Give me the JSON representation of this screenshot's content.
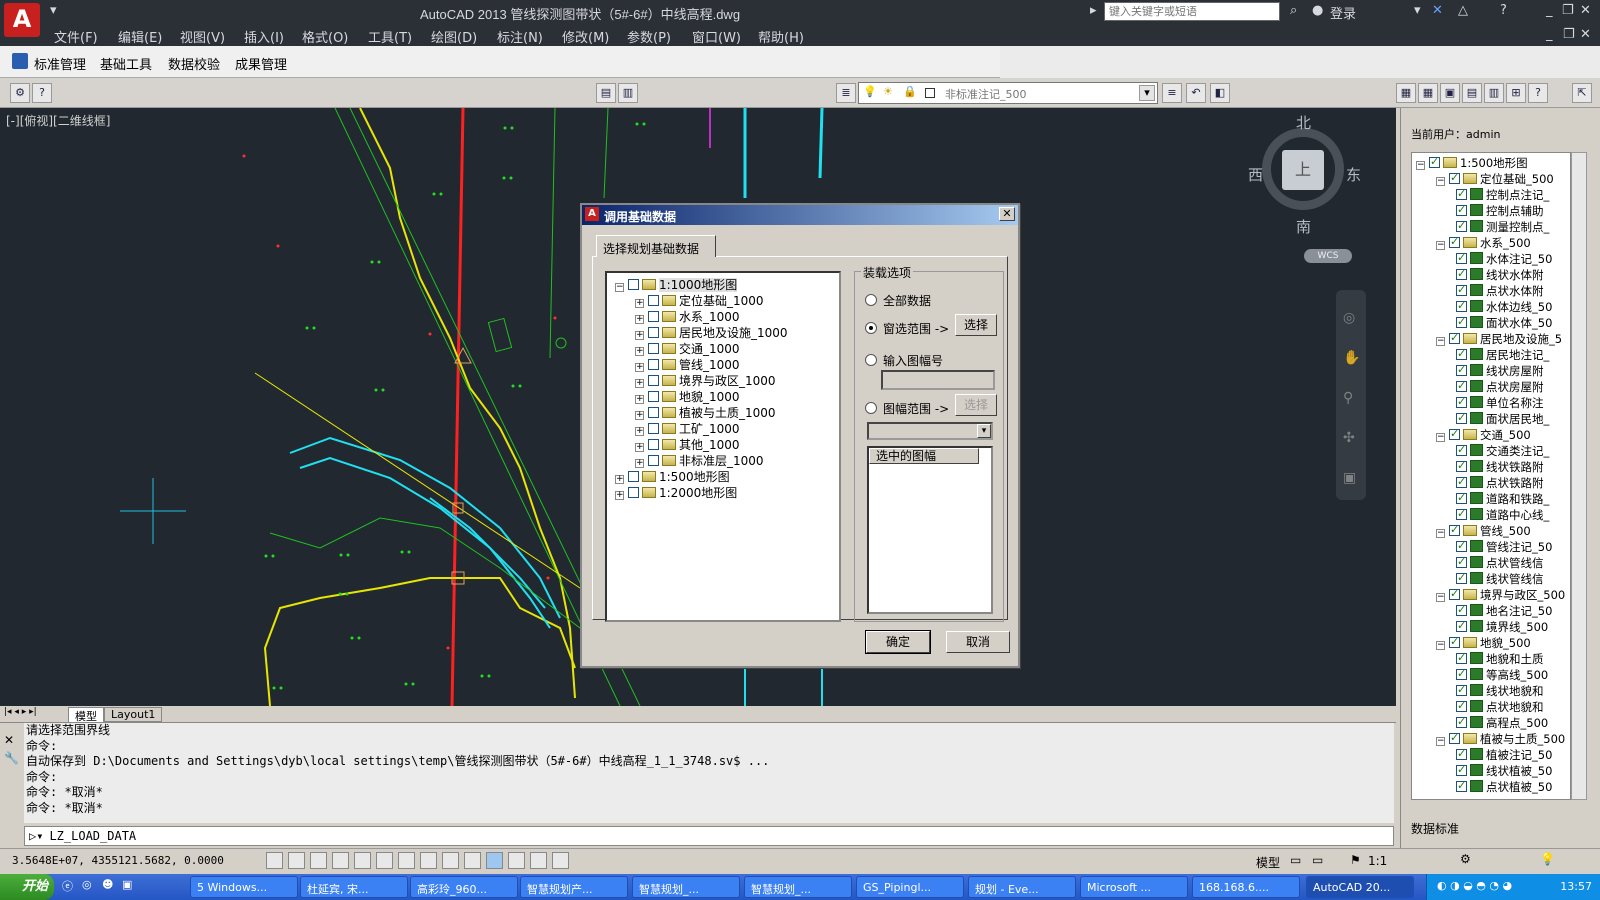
{
  "app": {
    "title": "AutoCAD 2013    管线探测图带状（5#-6#）中线高程.dwg",
    "search_placeholder": "键入关键字或短语",
    "login": "登录",
    "logo": "A"
  },
  "menu": [
    "文件(F)",
    "编辑(E)",
    "视图(V)",
    "插入(I)",
    "格式(O)",
    "工具(T)",
    "绘图(D)",
    "标注(N)",
    "修改(M)",
    "参数(P)",
    "窗口(W)",
    "帮助(H)"
  ],
  "custom_toolbar": [
    "标准管理",
    "基础工具",
    "数据校验",
    "成果管理"
  ],
  "layer_combo": "非标准注记_500",
  "viewport_label": "[-][俯视][二维线框]",
  "viewcube": {
    "north": "北",
    "south": "南",
    "east": "东",
    "west": "西",
    "top": "上",
    "wcs": "WCS"
  },
  "layout_tabs": [
    "模型",
    "Layout1"
  ],
  "command_history": [
    "请选择范围界线",
    "命令:",
    "自动保存到 D:\\Documents and Settings\\dyb\\local settings\\temp\\管线探测图带状（5#-6#）中线高程_1_1_3748.sv$ ...",
    "命令:",
    "命令: *取消*",
    "命令: *取消*"
  ],
  "command_input": "LZ_LOAD_DATA",
  "status": {
    "coords": "3.5648E+07, 4355121.5682, 0.0000",
    "model": "模型",
    "scale": "1:1"
  },
  "dialog": {
    "title": "调用基础数据",
    "tab": "选择规划基础数据",
    "tree": [
      {
        "label": "1:1000地形图",
        "level": 0,
        "expanded": true
      },
      {
        "label": "定位基础_1000",
        "level": 1
      },
      {
        "label": "水系_1000",
        "level": 1
      },
      {
        "label": "居民地及设施_1000",
        "level": 1
      },
      {
        "label": "交通_1000",
        "level": 1
      },
      {
        "label": "管线_1000",
        "level": 1
      },
      {
        "label": "境界与政区_1000",
        "level": 1
      },
      {
        "label": "地貌_1000",
        "level": 1
      },
      {
        "label": "植被与土质_1000",
        "level": 1
      },
      {
        "label": "工矿_1000",
        "level": 1
      },
      {
        "label": "其他_1000",
        "level": 1
      },
      {
        "label": "非标准层_1000",
        "level": 1
      },
      {
        "label": "1:500地形图",
        "level": 0
      },
      {
        "label": "1:2000地形图",
        "level": 0
      }
    ],
    "group_label": "装载选项",
    "options": {
      "all": "全部数据",
      "window": "窗选范围 ->",
      "input_sheet": "输入图幅号",
      "sheet_range": "图幅范围 ->"
    },
    "select_btn": "选择",
    "select_btn2": "选择",
    "list_header": "选中的图幅",
    "ok": "确定",
    "cancel": "取消"
  },
  "layer_panel": {
    "user": "当前用户：admin",
    "footer": "数据标准",
    "tree": [
      {
        "label": "1:500地形图",
        "level": 0,
        "group": true
      },
      {
        "label": "定位基础_500",
        "level": 1,
        "group": true
      },
      {
        "label": "控制点注记_",
        "level": 2
      },
      {
        "label": "控制点辅助",
        "level": 2
      },
      {
        "label": "测量控制点_",
        "level": 2
      },
      {
        "label": "水系_500",
        "level": 1,
        "group": true
      },
      {
        "label": "水体注记_50",
        "level": 2
      },
      {
        "label": "线状水体附",
        "level": 2
      },
      {
        "label": "点状水体附",
        "level": 2
      },
      {
        "label": "水体边线_50",
        "level": 2
      },
      {
        "label": "面状水体_50",
        "level": 2
      },
      {
        "label": "居民地及设施_5",
        "level": 1,
        "group": true
      },
      {
        "label": "居民地注记_",
        "level": 2
      },
      {
        "label": "线状房屋附",
        "level": 2
      },
      {
        "label": "点状房屋附",
        "level": 2
      },
      {
        "label": "单位名称注",
        "level": 2
      },
      {
        "label": "面状居民地_",
        "level": 2
      },
      {
        "label": "交通_500",
        "level": 1,
        "group": true
      },
      {
        "label": "交通类注记_",
        "level": 2
      },
      {
        "label": "线状铁路附",
        "level": 2
      },
      {
        "label": "点状铁路附",
        "level": 2
      },
      {
        "label": "道路和铁路_",
        "level": 2
      },
      {
        "label": "道路中心线_",
        "level": 2
      },
      {
        "label": "管线_500",
        "level": 1,
        "group": true
      },
      {
        "label": "管线注记_50",
        "level": 2
      },
      {
        "label": "点状管线信",
        "level": 2
      },
      {
        "label": "线状管线信",
        "level": 2
      },
      {
        "label": "境界与政区_500",
        "level": 1,
        "group": true
      },
      {
        "label": "地名注记_50",
        "level": 2
      },
      {
        "label": "境界线_500",
        "level": 2
      },
      {
        "label": "地貌_500",
        "level": 1,
        "group": true
      },
      {
        "label": "地貌和土质",
        "level": 2
      },
      {
        "label": "等高线_500",
        "level": 2
      },
      {
        "label": "线状地貌和",
        "level": 2
      },
      {
        "label": "点状地貌和",
        "level": 2
      },
      {
        "label": "高程点_500",
        "level": 2
      },
      {
        "label": "植被与土质_500",
        "level": 1,
        "group": true
      },
      {
        "label": "植被注记_50",
        "level": 2
      },
      {
        "label": "线状植被_50",
        "level": 2
      },
      {
        "label": "点状植被_50",
        "level": 2
      }
    ]
  },
  "taskbar": {
    "start": "开始",
    "tasks": [
      "5 Windows...",
      "杜延宾, 宋...",
      "高彩玲_960...",
      "智慧规划产...",
      "智慧规划_...",
      "智慧规划_...",
      "GS_Pipingl...",
      "规划 - Eve...",
      "Microsoft ...",
      "168.168.6....",
      "AutoCAD 20..."
    ],
    "clock": "13:57"
  },
  "colors": {
    "canvas": "#212830",
    "title_bar": "#2b2f36",
    "dialog_title": "#0a246a"
  }
}
